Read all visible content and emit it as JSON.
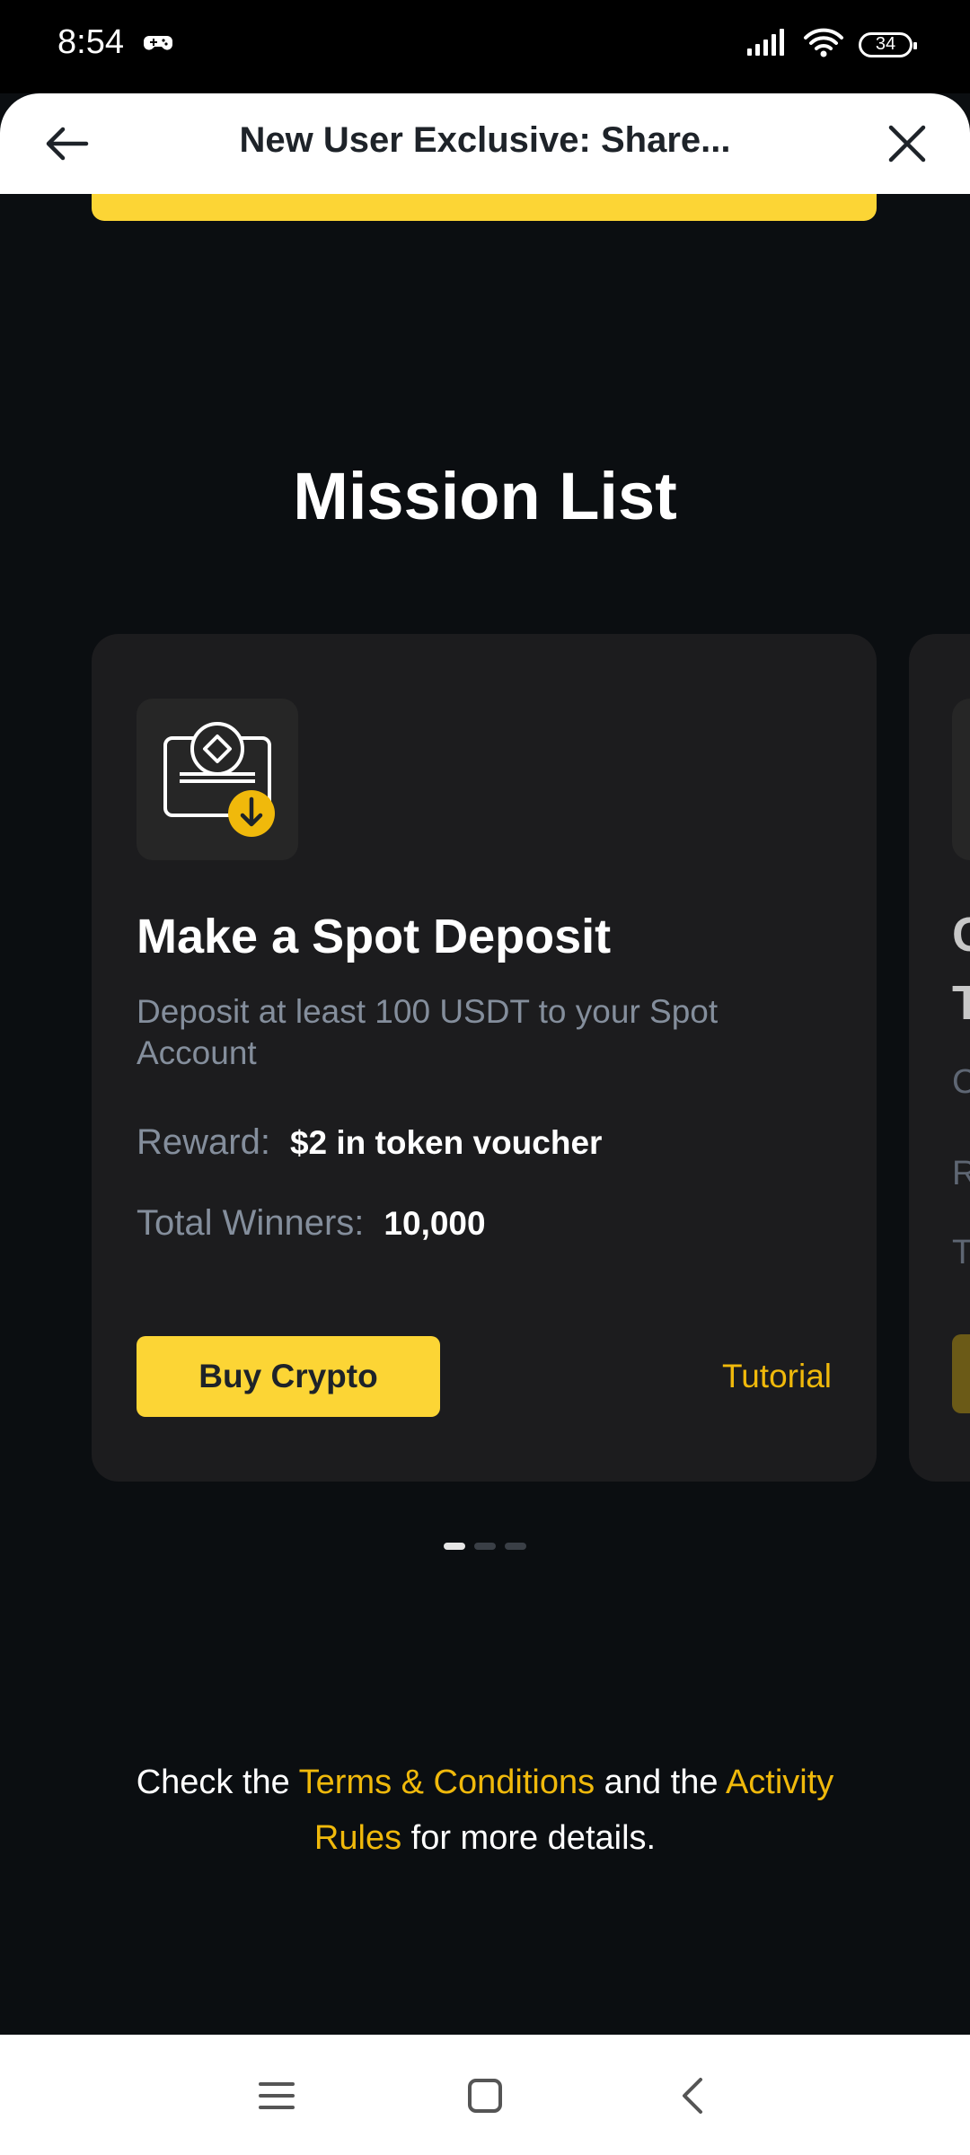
{
  "status_bar": {
    "time": "8:54",
    "battery": "34",
    "icons": [
      "gamepad-icon",
      "signal-icon",
      "wifi-icon",
      "battery-icon"
    ]
  },
  "header": {
    "title": "New User Exclusive: Share...",
    "back_icon": "arrow-left-icon",
    "close_icon": "close-icon"
  },
  "main": {
    "section_title": "Mission List",
    "missions": [
      {
        "title": "Make a Spot Deposit",
        "description": "Deposit at least 100 USDT to your Spot Account",
        "reward_label": "Reward:",
        "reward_value": "$2 in token voucher",
        "winners_label": "Total Winners:",
        "winners_value": "10,000",
        "button_label": "Buy Crypto",
        "link_label": "Tutorial",
        "icon": "deposit-icon"
      }
    ],
    "next_card_peek": {
      "line1": "C",
      "line2": "T",
      "line3": "C",
      "line4": "R",
      "line5": "T"
    },
    "pagination": {
      "count": 3,
      "active": 1
    }
  },
  "footer": {
    "prefix": "Check the ",
    "terms_link": "Terms & Conditions",
    "middle": " and the ",
    "rules_link": "Activity Rules",
    "suffix": " for more details."
  },
  "nav_bar": {
    "icons": [
      "menu-icon",
      "home-icon",
      "back-icon"
    ]
  },
  "colors": {
    "accent": "#fcd535",
    "link": "#f0b90b",
    "background": "#0b0e11",
    "card": "#1c1c1e",
    "muted_text": "#848e9c"
  }
}
